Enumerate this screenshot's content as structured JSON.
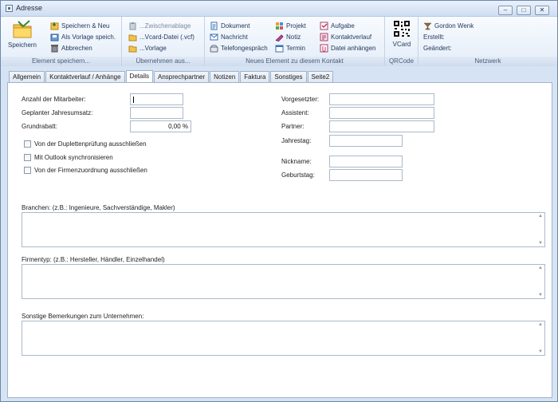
{
  "window": {
    "title": "Adresse",
    "controls": [
      "–",
      "□",
      "✕"
    ]
  },
  "ribbon": {
    "groups": [
      {
        "label": "Element speichern...",
        "big_button": {
          "label": "Speichern",
          "icon": "save-folder-icon"
        },
        "items": [
          {
            "label": "Speichern & Neu",
            "icon": "save-new-icon",
            "disabled": false
          },
          {
            "label": "Als Vorlage speich.",
            "icon": "save-template-icon",
            "disabled": false
          },
          {
            "label": "Abbrechen",
            "icon": "trash-icon",
            "disabled": false
          }
        ]
      },
      {
        "label": "Übernehmen aus...",
        "items": [
          {
            "label": "...Zwischenablage",
            "icon": "clipboard-icon",
            "disabled": true
          },
          {
            "label": "...Vcard-Datei (.vcf)",
            "icon": "folder-open-icon",
            "disabled": false
          },
          {
            "label": "...Vorlage",
            "icon": "folder-open-icon",
            "disabled": false
          }
        ]
      },
      {
        "label": "Neues Element zu diesem Kontakt",
        "items": [
          {
            "label": "Dokument",
            "icon": "document-icon"
          },
          {
            "label": "Nachricht",
            "icon": "message-icon"
          },
          {
            "label": "Telefongespräch",
            "icon": "phone-icon"
          },
          {
            "label": "Projekt",
            "icon": "project-icon"
          },
          {
            "label": "Notiz",
            "icon": "note-icon"
          },
          {
            "label": "Termin",
            "icon": "calendar-icon"
          },
          {
            "label": "Aufgabe",
            "icon": "task-icon"
          },
          {
            "label": "Kontaktverlauf",
            "icon": "history-icon"
          },
          {
            "label": "Datei anhängen",
            "icon": "attach-icon"
          }
        ]
      },
      {
        "label": "QRCode",
        "big_button": {
          "label": "VCard",
          "icon": "qrcode-icon"
        }
      },
      {
        "label": "Netzwerk",
        "items": [
          {
            "label": "Gordon Wenk",
            "icon": "user-icon"
          },
          {
            "label": "Erstellt:",
            "icon": ""
          },
          {
            "label": "Geändert:",
            "icon": ""
          }
        ]
      }
    ]
  },
  "tabs": [
    {
      "label": "Allgemein",
      "active": false
    },
    {
      "label": "Kontaktverlauf / Anhänge",
      "active": false
    },
    {
      "label": "Details",
      "active": true
    },
    {
      "label": "Ansprechpartner",
      "active": false
    },
    {
      "label": "Notizen",
      "active": false
    },
    {
      "label": "Faktura",
      "active": false
    },
    {
      "label": "Sonstiges",
      "active": false
    },
    {
      "label": "Seite2",
      "active": false
    }
  ],
  "details": {
    "left_fields": [
      {
        "label": "Anzahl der Mitarbeiter:",
        "value": ""
      },
      {
        "label": "Geplanter Jahresumsatz:",
        "value": ""
      },
      {
        "label": "Grundrabatt:",
        "value": "0,00 %"
      }
    ],
    "checkboxes": [
      {
        "label": "Von der Duplettenprüfung ausschließen",
        "checked": false
      },
      {
        "label": "Mit Outlook synchronisieren",
        "checked": false
      },
      {
        "label": "Von der Firmenzuordnung ausschließen",
        "checked": false
      }
    ],
    "right_fields": [
      {
        "label": "Vorgesetzter:",
        "value": ""
      },
      {
        "label": "Assistent:",
        "value": ""
      },
      {
        "label": "Partner:",
        "value": ""
      },
      {
        "label": "Jahrestag:",
        "value": ""
      },
      {
        "label": "Nickname:",
        "value": ""
      },
      {
        "label": "Geburtstag:",
        "value": ""
      }
    ],
    "textareas": [
      {
        "label": "Branchen:  (z.B.: Ingenieure, Sachverständige, Makler)",
        "value": ""
      },
      {
        "label": "Firmentyp: (z.B.: Hersteller, Händler, Einzelhandel)",
        "value": ""
      },
      {
        "label": "Sonstige Bemerkungen zum Unternehmen:",
        "value": ""
      }
    ]
  }
}
